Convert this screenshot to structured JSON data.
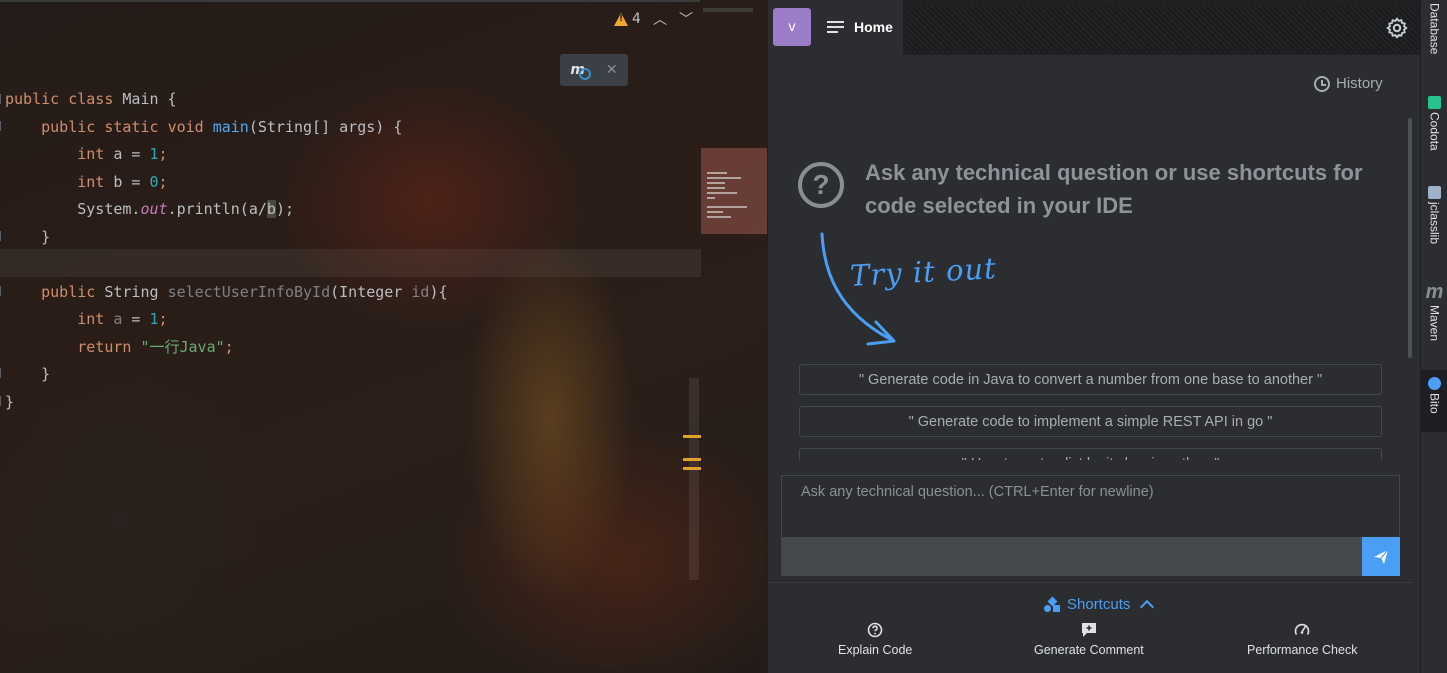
{
  "editor": {
    "inspections": {
      "warning_count": "4"
    },
    "floating_toolbar": {
      "icon": "mybatis-generator-icon",
      "close": "✕"
    },
    "code_lines": [
      [
        [
          "kw",
          "public "
        ],
        [
          "kw",
          "class "
        ],
        [
          "plain",
          "Main {"
        ]
      ],
      [
        [
          "plain",
          "    "
        ],
        [
          "kw",
          "public "
        ],
        [
          "kw",
          "static "
        ],
        [
          "kw",
          "void "
        ],
        [
          "fn",
          "main"
        ],
        [
          "plain",
          "(String[] args) {"
        ]
      ],
      [
        [
          "plain",
          "        "
        ],
        [
          "kw",
          "int "
        ],
        [
          "plain",
          "a = "
        ],
        [
          "num",
          "1"
        ],
        [
          "kw",
          ";"
        ]
      ],
      [
        [
          "plain",
          "        "
        ],
        [
          "kw",
          "int "
        ],
        [
          "plain",
          "b = "
        ],
        [
          "num",
          "0"
        ],
        [
          "kw",
          ";"
        ]
      ],
      [
        [
          "plain",
          "        System."
        ],
        [
          "fld",
          "out"
        ],
        [
          "plain",
          ".println(a/"
        ],
        [
          "hl",
          "b"
        ],
        [
          "plain",
          ");"
        ]
      ],
      [
        [
          "plain",
          "    }"
        ]
      ],
      [
        [
          "plain",
          ""
        ]
      ],
      [
        [
          "plain",
          "    "
        ],
        [
          "kw",
          "public "
        ],
        [
          "plain",
          "String "
        ],
        [
          "unused",
          "selectUserInfoById"
        ],
        [
          "plain",
          "(Integer "
        ],
        [
          "unused",
          "id"
        ],
        [
          "plain",
          "){"
        ]
      ],
      [
        [
          "plain",
          "        "
        ],
        [
          "kw",
          "int "
        ],
        [
          "unused",
          "a"
        ],
        [
          "plain",
          " = "
        ],
        [
          "num",
          "1"
        ],
        [
          "kw",
          ";"
        ]
      ],
      [
        [
          "plain",
          "        "
        ],
        [
          "kw",
          "return "
        ],
        [
          "str",
          "\"一行Java\""
        ],
        [
          "kw",
          ";"
        ]
      ],
      [
        [
          "plain",
          "    }"
        ]
      ],
      [
        [
          "plain",
          "}"
        ]
      ]
    ]
  },
  "panel": {
    "avatar_letter": "v",
    "home_tab": "Home",
    "history_label": "History",
    "empty_state": {
      "heading": "Ask any technical question or use shortcuts for code selected in your IDE",
      "try_it": "Try it out"
    },
    "suggestions": [
      "\" Generate code in Java to convert a number from one base to another \"",
      "\" Generate code to implement a simple REST API in go \"",
      "\" How to sort a dict by its key in python \""
    ],
    "input": {
      "placeholder": "Ask any technical question... (CTRL+Enter for newline)",
      "value": ""
    },
    "shortcuts_label": "Shortcuts",
    "shortcut_actions": [
      {
        "label": "Explain Code",
        "icon": "question-circle-icon"
      },
      {
        "label": "Generate Comment",
        "icon": "comment-plus-icon"
      },
      {
        "label": "Performance Check",
        "icon": "gauge-icon"
      }
    ],
    "colors": {
      "accent": "#4a9ef5",
      "avatar": "#9b7cc6",
      "panel_bg": "#2b2d30"
    }
  },
  "tool_strip": [
    {
      "label": "Database",
      "icon": "database-icon"
    },
    {
      "label": "Codota",
      "icon": "codota-icon"
    },
    {
      "label": "jclasslib",
      "icon": "jclasslib-icon"
    },
    {
      "label": "Maven",
      "icon": "maven-icon"
    },
    {
      "label": "Bito",
      "icon": "bito-icon",
      "active": true
    }
  ]
}
